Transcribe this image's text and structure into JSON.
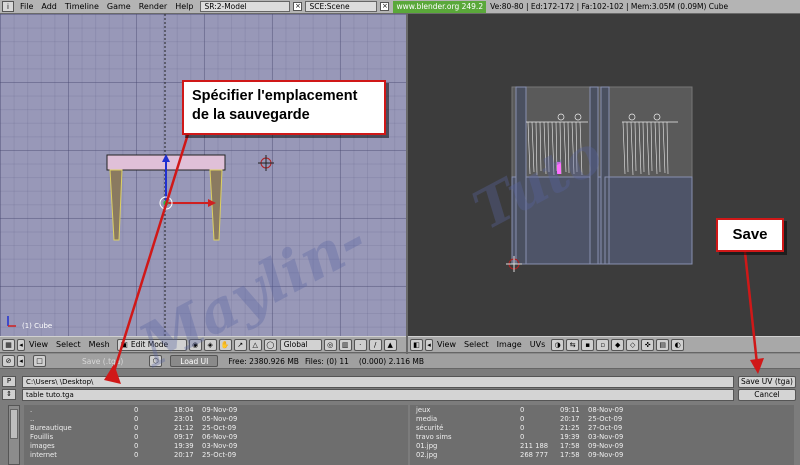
{
  "topbar": {
    "menus": [
      "File",
      "Add",
      "Timeline",
      "Game",
      "Render",
      "Help"
    ],
    "screen": "SR:2-Model",
    "scene": "SCE:Scene",
    "url": "www.blender.org 249.2",
    "stats": "Ve:80-80 | Ed:172-172 | Fa:102-102 | Mem:3.05M (0.09M) Cube"
  },
  "view3d": {
    "object_label": "(1) Cube",
    "header": {
      "menus": [
        "View",
        "Select",
        "Mesh"
      ],
      "mode": "Edit Mode",
      "orientation": "Global"
    }
  },
  "uv_editor": {
    "header": {
      "menus": [
        "View",
        "Select",
        "Image",
        "UVs"
      ]
    }
  },
  "file_header": {
    "save_label": "Save (.tga)",
    "load_ui_label": "Load UI",
    "free_label": "Free: 2380.926 MB",
    "files_label": "Files: (0) 11",
    "size_label": "(0.000) 2.116 MB"
  },
  "file_panel": {
    "path_value": "C:\\Users\\        \\Desktop\\",
    "filename_value": "table tuto.tga",
    "save_button_label": "Save UV (tga)",
    "cancel_button_label": "Cancel",
    "row_control_p": "P",
    "row_control_arrows": "⇕",
    "left_files": [
      {
        "name": ".",
        "size": "0",
        "time": "18:04",
        "date": "09-Nov-09"
      },
      {
        "name": "..",
        "size": "0",
        "time": "23:01",
        "date": "05-Nov-09"
      },
      {
        "name": "Bureautique",
        "size": "0",
        "time": "21:12",
        "date": "25-Oct-09"
      },
      {
        "name": "Fouillis",
        "size": "0",
        "time": "09:17",
        "date": "06-Nov-09"
      },
      {
        "name": "images",
        "size": "0",
        "time": "19:39",
        "date": "03-Nov-09"
      },
      {
        "name": "internet",
        "size": "0",
        "time": "20:17",
        "date": "25-Oct-09"
      }
    ],
    "right_files": [
      {
        "name": "jeux",
        "size": "0",
        "time": "09:11",
        "date": "08-Nov-09"
      },
      {
        "name": "media",
        "size": "0",
        "time": "20:17",
        "date": "25-Oct-09"
      },
      {
        "name": "sécurité",
        "size": "0",
        "time": "21:25",
        "date": "27-Oct-09"
      },
      {
        "name": "travo sims",
        "size": "0",
        "time": "19:39",
        "date": "03-Nov-09"
      },
      {
        "name": "01.jpg",
        "size": "211 188",
        "time": "17:58",
        "date": "09-Nov-09"
      },
      {
        "name": "02.jpg",
        "size": "268 777",
        "time": "17:58",
        "date": "09-Nov-09"
      }
    ]
  },
  "annotations": {
    "location_callout": "Spécifier l'emplacement de la sauvegarde",
    "save_callout": "Save",
    "accent_color": "#d01818"
  },
  "watermark": {
    "left": "Maylin-",
    "right": "Tuto"
  }
}
